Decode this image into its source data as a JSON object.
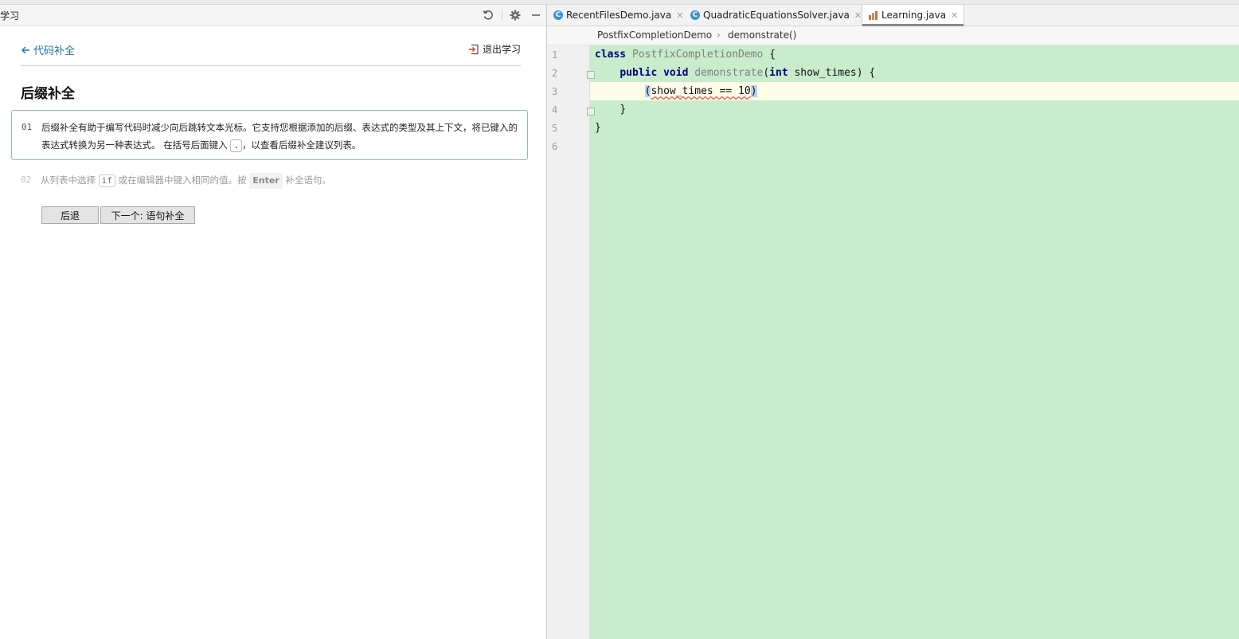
{
  "left_panel": {
    "title": "学习",
    "back_link": "代码补全",
    "exit_link": "退出学习",
    "lesson_title": "后缀补全",
    "step1": {
      "number": "01",
      "text_before": "后缀补全有助于编写代码时减少向后跳转文本光标。它支持您根据添加的后缀、表达式的类型及其上下文，将已键入的表达式转换为另一种表达式。 在括号后面键入 ",
      "key": ".",
      "text_after": "，以查看后缀补全建议列表。"
    },
    "step2": {
      "number": "02",
      "text_before": "从列表中选择 ",
      "code": "if",
      "text_middle": " 或在编辑器中键入相同的值。按 ",
      "key": "Enter",
      "text_after": " 补全语句。"
    },
    "buttons": {
      "back": "后退",
      "next": "下一个: 语句补全"
    },
    "icons": [
      "reset-icon",
      "gear-icon",
      "minimize-icon",
      "arrow-left-icon",
      "exit-icon"
    ]
  },
  "editor": {
    "tabs": [
      {
        "label": "RecentFilesDemo.java",
        "icon": "C"
      },
      {
        "label": "QuadraticEquationsSolver.java",
        "icon": "C"
      },
      {
        "label": "Learning.java",
        "icon": ""
      }
    ],
    "breadcrumb": {
      "class_name": "PostfixCompletionDemo",
      "separator": "›",
      "method": "demonstrate()"
    },
    "line_numbers": [
      "1",
      "2",
      "3",
      "4",
      "5",
      "6"
    ],
    "code": {
      "line1_kw": "class",
      "line1_name": "PostfixCompletionDemo",
      "line1_brace": " {",
      "line2_kw1": "public",
      "line2_kw2": "void",
      "line2_fn": "demonstrate",
      "line2_paren_open": "(",
      "line2_kw3": "int",
      "line2_param": " show_times) {",
      "line3_open": "(",
      "line3_expr": "show_times == 10",
      "line3_close": ")",
      "line4": "}",
      "line5": "}"
    },
    "colors": {
      "background": "#c8eccc",
      "current_line": "#fefbe8",
      "keyword": "#000080"
    }
  }
}
